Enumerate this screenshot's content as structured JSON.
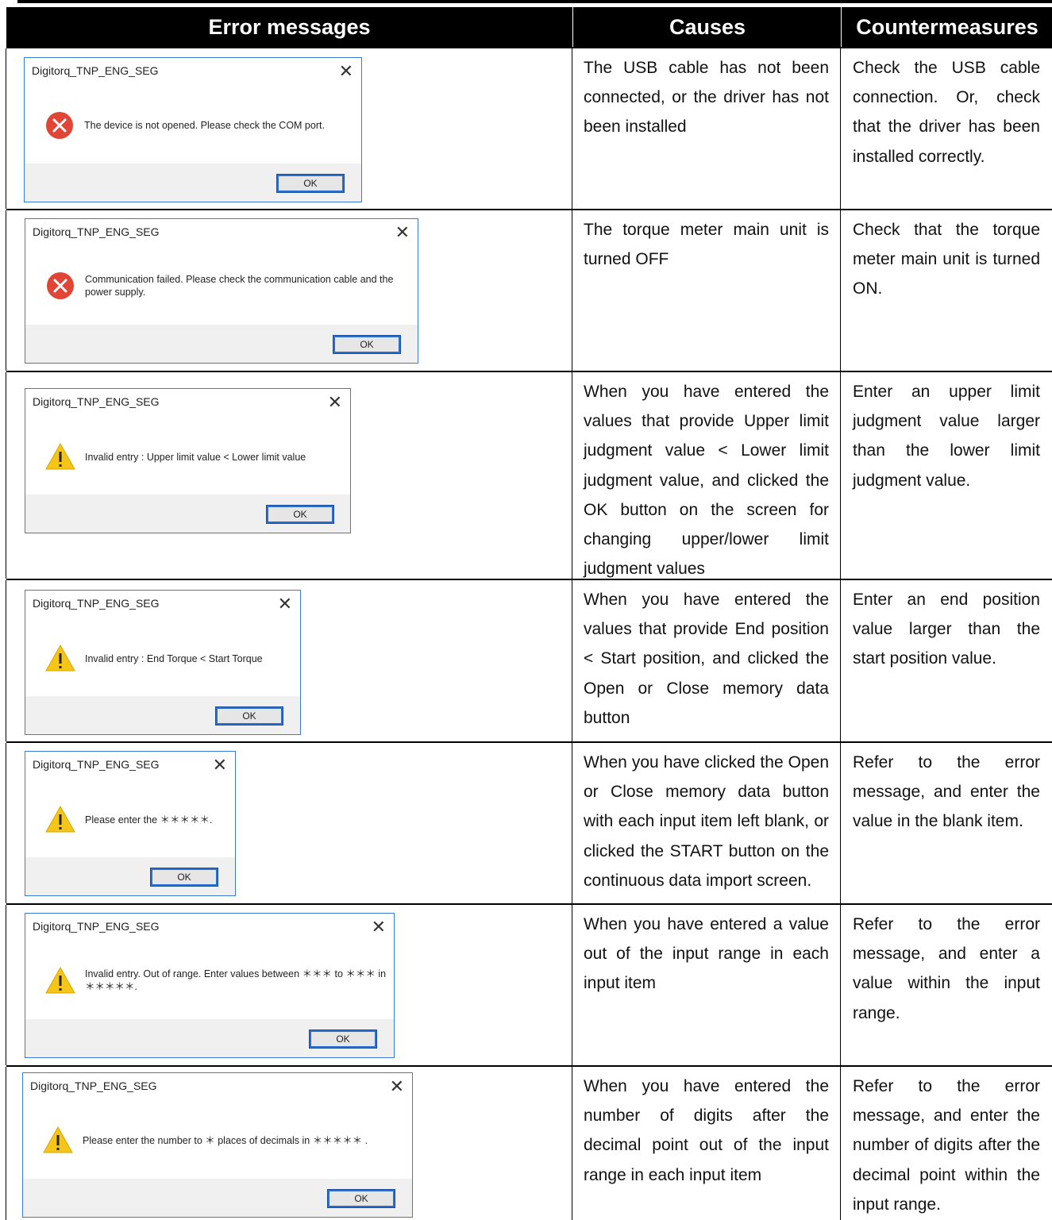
{
  "header": {
    "col1": "Error messages",
    "col2": "Causes",
    "col3": "Countermeasures"
  },
  "rows": [
    {
      "dialog": {
        "title": "Digitorq_TNP_ENG_SEG",
        "icon": "error-icon",
        "message": "The device is not opened. Please check the COM port.",
        "ok": "OK"
      },
      "cause": "The USB cable has not been connected, or the driver has not been installed",
      "countermeasure": "Check the USB cable connection. Or, check that the driver has been installed correctly."
    },
    {
      "dialog": {
        "title": "Digitorq_TNP_ENG_SEG",
        "icon": "error-icon",
        "message": "Communication failed. Please check the communication cable and the power supply.",
        "ok": "OK"
      },
      "cause": "The torque meter main unit is turned OFF",
      "countermeasure": "Check that the torque meter main unit is turned ON."
    },
    {
      "dialog": {
        "title": "Digitorq_TNP_ENG_SEG",
        "icon": "warning-icon",
        "message": "Invalid entry : Upper limit value < Lower limit value",
        "ok": "OK"
      },
      "cause": "When you have entered the values that provide Upper limit judgment value < Lower limit judgment value, and clicked the OK button on the screen for changing upper/lower limit judgment values",
      "countermeasure": "Enter an upper limit judgment value larger than the lower limit judgment value."
    },
    {
      "dialog": {
        "title": "Digitorq_TNP_ENG_SEG",
        "icon": "warning-icon",
        "message": "Invalid entry : End Torque < Start Torque",
        "ok": "OK"
      },
      "cause": "When you have entered the values that provide End position < Start position, and clicked the Open or Close memory data button",
      "countermeasure": "Enter an end position value larger than the start position value."
    },
    {
      "dialog": {
        "title": "Digitorq_TNP_ENG_SEG",
        "icon": "warning-icon",
        "message": "Please enter the ＊＊＊＊＊.",
        "ok": "OK"
      },
      "cause": "When you have clicked the Open or Close memory data button with each input item left blank, or clicked the START button on the continuous data import screen.",
      "countermeasure": "Refer to the error message, and enter the value in the blank item."
    },
    {
      "dialog": {
        "title": "Digitorq_TNP_ENG_SEG",
        "icon": "warning-icon",
        "message": "Invalid entry. Out of range. Enter values between ＊＊＊ to ＊＊＊ in ＊＊＊＊＊.",
        "ok": "OK"
      },
      "cause": "When you have entered a value out of the input range in each input item",
      "countermeasure": "Refer to the error message, and enter a value within the input range."
    },
    {
      "dialog": {
        "title": "Digitorq_TNP_ENG_SEG",
        "icon": "warning-icon",
        "message": "Please enter the number to ＊ places of decimals in ＊＊＊＊＊ .",
        "ok": "OK"
      },
      "cause": "When you have entered the number of digits after the decimal point out of the input range in each input item",
      "countermeasure": "Refer to the error message, and enter the number of digits after the decimal point within the input range."
    }
  ]
}
